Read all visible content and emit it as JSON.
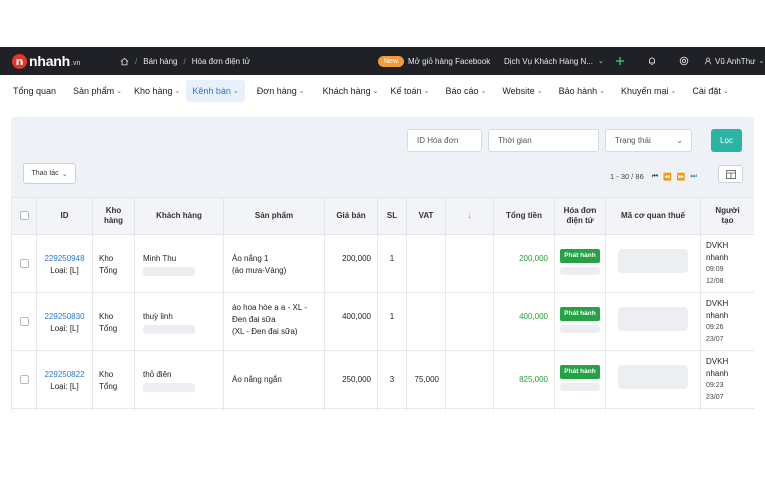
{
  "brand": {
    "logo_letter": "n",
    "name": "nhanh",
    "suffix": ".vn"
  },
  "breadcrumb": [
    "Bán hàng",
    "Hóa đơn điện tử"
  ],
  "topbar": {
    "new_badge": "New",
    "new_text": "Mở giỏ hàng Facebook",
    "service": "Dịch Vụ Khách Hàng N...",
    "user": "Vũ AnhThư"
  },
  "menu": [
    {
      "label": "Tổng quan",
      "dropdown": false
    },
    {
      "label": "Sản phẩm",
      "dropdown": true
    },
    {
      "label": "Kho hàng",
      "dropdown": true
    },
    {
      "label": "Kênh bán",
      "dropdown": true,
      "active": true
    },
    {
      "label": "Đơn hàng",
      "dropdown": true
    },
    {
      "label": "Khách hàng",
      "dropdown": true
    },
    {
      "label": "Kế toán",
      "dropdown": true
    },
    {
      "label": "Báo cáo",
      "dropdown": true
    },
    {
      "label": "Website",
      "dropdown": true
    },
    {
      "label": "Bảo hành",
      "dropdown": true
    },
    {
      "label": "Khuyến mại",
      "dropdown": true
    },
    {
      "label": "Cài đặt",
      "dropdown": true
    }
  ],
  "filters": {
    "invoice_id_placeholder": "ID Hóa đơn",
    "time_placeholder": "Thời gian",
    "status_placeholder": "Trạng thái",
    "filter_button": "Lọc"
  },
  "actions_label": "Thao tác",
  "pagination": {
    "range": "1 - 30 / 86"
  },
  "table": {
    "headers": {
      "id": "ID",
      "kho_line1": "Kho",
      "kho_line2": "hàng",
      "customer": "Khách hàng",
      "product": "Sản phẩm",
      "price": "Giá bán",
      "qty": "SL",
      "vat": "VAT",
      "total": "Tổng tiền",
      "einvoice_line1": "Hóa đơn",
      "einvoice_line2": "điện tử",
      "tax_code": "Mã cơ quan thuế",
      "creator_line1": "Người",
      "creator_line2": "tạo"
    },
    "rows": [
      {
        "id": "229250948",
        "type": "Loại: [L]",
        "kho1": "Kho",
        "kho2": "Tổng",
        "customer": "Minh Thu",
        "product1": "Áo nắng 1",
        "product2": "(áo mưa-Vàng)",
        "product3": "",
        "price": "200,000",
        "qty": "1",
        "vat": "",
        "total": "200,000",
        "status": "Phát hành",
        "creator1": "DVKH",
        "creator2": "nhanh",
        "time1": "09:09",
        "time2": "12/08"
      },
      {
        "id": "229250830",
        "type": "Loại: [L]",
        "kho1": "Kho",
        "kho2": "Tổng",
        "customer": "thuỳ linh",
        "product1": "áo hoa hòe a a - XL -",
        "product2": "Đen đai sữa",
        "product3": "(XL - Đen đai sữa)",
        "price": "400,000",
        "qty": "1",
        "vat": "",
        "total": "400,000",
        "status": "Phát hành",
        "creator1": "DVKH",
        "creator2": "nhanh",
        "time1": "09:26",
        "time2": "23/07"
      },
      {
        "id": "229250822",
        "type": "Loại: [L]",
        "kho1": "Kho",
        "kho2": "Tổng",
        "customer": "thỏ điên",
        "product1": "Áo nắng ngắn",
        "product2": "",
        "product3": "",
        "price": "250,000",
        "qty": "3",
        "vat": "75,000",
        "total": "825,000",
        "status": "Phát hành",
        "creator1": "DVKH",
        "creator2": "nhanh",
        "time1": "09:23",
        "time2": "23/07"
      }
    ]
  },
  "colors": {
    "accent": "#2a77d4",
    "success": "#25a244",
    "brand_red": "#e5352b",
    "filter_button": "#2bb3a3",
    "topbar": "#1f2127"
  }
}
